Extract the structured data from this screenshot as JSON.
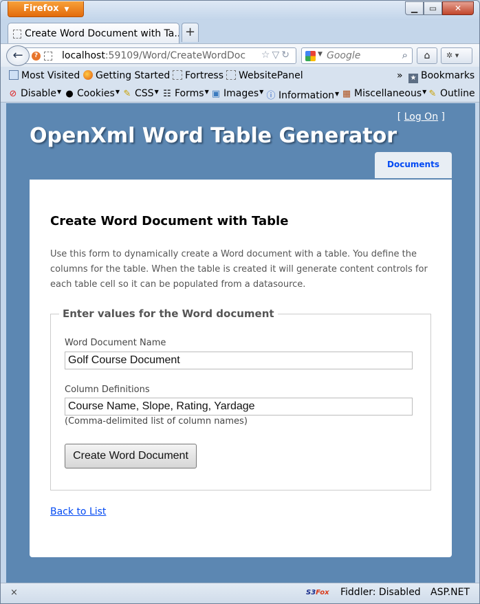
{
  "browser": {
    "app_button": "Firefox",
    "tab_title": "Create Word Document with Ta...",
    "url_host": "localhost",
    "url_path": ":59109/Word/CreateWordDoc",
    "search_placeholder": "Google"
  },
  "bookmarks": {
    "items": [
      "Most Visited",
      "Getting Started",
      "Fortress",
      "WebsitePanel"
    ],
    "more": "»",
    "bookmarks_label": "Bookmarks"
  },
  "devbar": {
    "items": [
      "Disable",
      "Cookies",
      "CSS",
      "Forms",
      "Images",
      "Information",
      "Miscellaneous",
      "Outline"
    ]
  },
  "page": {
    "logon_open": "[",
    "logon_link": "Log On",
    "logon_close": "]",
    "site_title": "OpenXml Word Table Generator",
    "menu_tab": "Documents",
    "heading": "Create Word Document with Table",
    "intro": "Use this form to dynamically create a Word document with a table. You define the columns for the table. When the table is created it will generate content controls for each table cell so it can be populated from a datasource.",
    "legend": "Enter values for the Word document",
    "name_label": "Word Document Name",
    "name_value": "Golf Course Document",
    "columns_label": "Column Definitions",
    "columns_value": "Course Name, Slope, Rating, Yardage",
    "columns_hint": "(Comma-delimited list of column names)",
    "submit_label": "Create Word Document",
    "back_link": "Back to List"
  },
  "statusbar": {
    "close": "×",
    "s3fox_a": "S3",
    "s3fox_b": "Fox",
    "fiddler": "Fiddler: Disabled",
    "aspnet": "ASP.NET"
  }
}
